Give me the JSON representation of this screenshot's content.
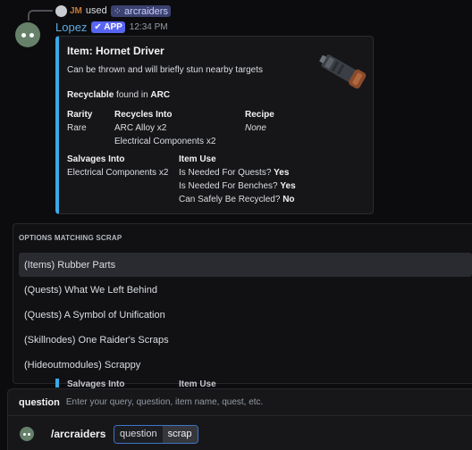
{
  "reply": {
    "initials": "JM",
    "used_text": "used",
    "command": "arcraiders"
  },
  "message": {
    "username": "Lopez",
    "app_badge": "APP",
    "timestamp": "12:34 PM"
  },
  "embed": {
    "title": "Item: Hornet Driver",
    "description": "Can be thrown and will briefly stun nearby targets",
    "recyclable_label": "Recyclable",
    "found_in_text": "found in",
    "found_in_value": "ARC",
    "accent_color": "#3aa9e6",
    "fields": {
      "rarity": {
        "name": "Rarity",
        "value": "Rare"
      },
      "recycles_into": {
        "name": "Recycles Into",
        "values": [
          "ARC Alloy x2",
          "Electrical Components x2"
        ]
      },
      "recipe": {
        "name": "Recipe",
        "value": "None"
      },
      "salvages_into": {
        "name": "Salvages Into",
        "value": "Electrical Components x2"
      },
      "item_use": {
        "name": "Item Use",
        "lines": [
          {
            "label": "Is Needed For Quests?",
            "value": "Yes"
          },
          {
            "label": "Is Needed For Benches?",
            "value": "Yes"
          },
          {
            "label": "Can Safely Be Recycled?",
            "value": "No"
          }
        ]
      }
    },
    "thumbnail_icon": "hornet-driver-item-icon"
  },
  "options": {
    "header": "OPTIONS MATCHING SCRAP",
    "items": [
      "(Items) Rubber Parts",
      "(Quests) What We Left Behind",
      "(Quests) A Symbol of Unification",
      "(Skillnodes) One Raider's Scraps",
      "(Hideoutmodules) Scrappy"
    ],
    "active_index": 0
  },
  "peek": {
    "salvages": "Salvages Into",
    "item_use": "Item Use"
  },
  "input": {
    "param_name": "question",
    "param_desc": "Enter your query, question, item name, quest, etc.",
    "command": "/arcraiders",
    "option_key": "question",
    "option_value": "scrap"
  }
}
